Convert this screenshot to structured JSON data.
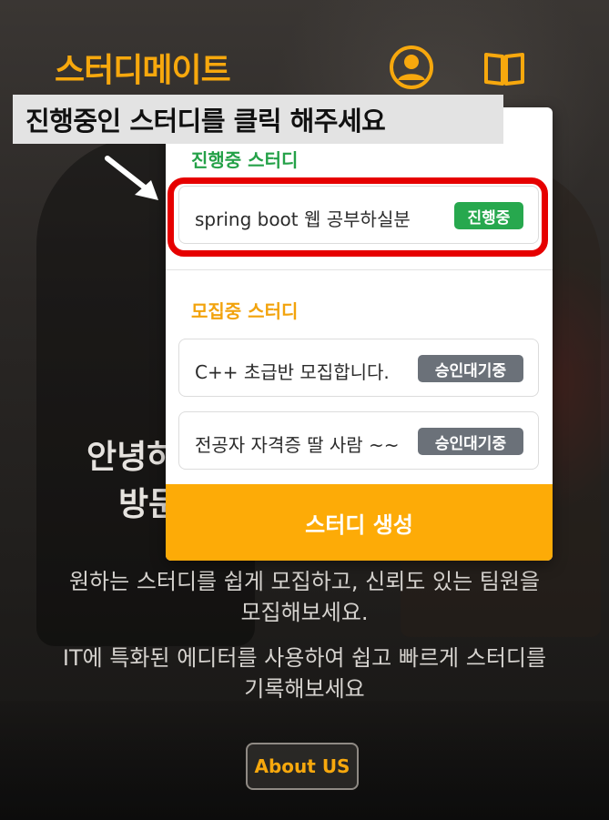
{
  "header": {
    "logo": "스터디메이트",
    "user_icon": "user-circle-icon",
    "book_icon": "open-book-icon",
    "accent_color": "#f7a80d"
  },
  "hero": {
    "title_line1": "안녕하",
    "title_line2": "방문",
    "desc1_line1": "원하는 스터디를 쉽게 모집하고, 신뢰도 있는 팀원을",
    "desc1_line2": "모집해보세요.",
    "desc2_line1": "IT에 특화된 에디터를 사용하여 쉽고 빠르게 스터디를",
    "desc2_line2": "기록해보세요",
    "about_button": "About US"
  },
  "popup": {
    "active_section_title": "진행중 스터디",
    "active_studies": [
      {
        "name": "spring boot 웹 공부하실분",
        "badge": "진행중"
      }
    ],
    "recruit_section_title": "모집중 스터디",
    "recruiting_studies": [
      {
        "name": "C++ 초급반 모집합니다.",
        "badge": "승인대기중"
      },
      {
        "name": "전공자 자격증 딸 사람 ~~",
        "badge": "승인대기중"
      }
    ],
    "create_button": "스터디 생성",
    "colors": {
      "active": "#24a148",
      "recruit": "#f2a30c",
      "wait_badge": "#6b7179",
      "create_button": "#fdab07"
    }
  },
  "annotation": {
    "instruction": "진행중인 스터디를 클릭 해주세요",
    "highlight_color": "#e60000"
  }
}
